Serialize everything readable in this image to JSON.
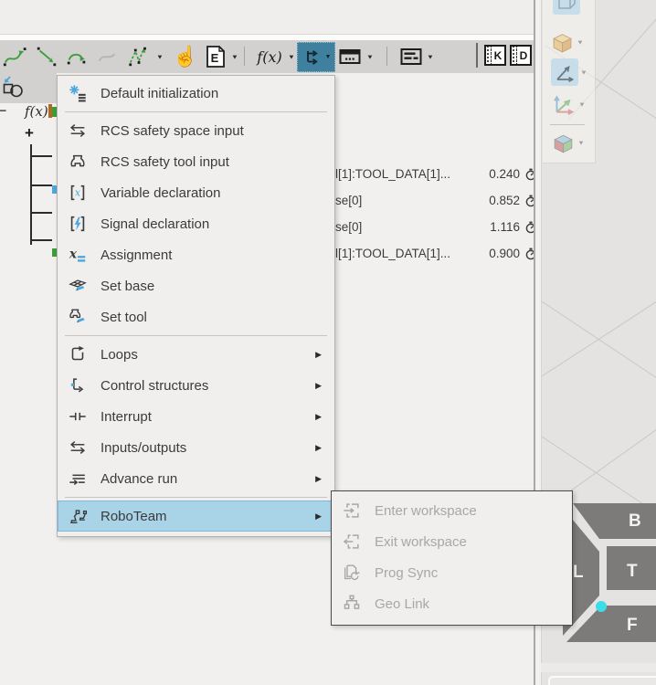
{
  "toolbar": {
    "e_button": "E",
    "fx_button": "f(x)",
    "k_button": "K",
    "d_button": "D",
    "selected_tool": "logic-commands",
    "motion_icons": [
      "spline-motion-icon",
      "linear-motion-icon",
      "circular-motion-icon",
      "spline-disabled-icon",
      "ptp-motion-icon",
      "grab-hand-icon"
    ]
  },
  "glyphs": {
    "caret_down": "▼",
    "submenu_arrow": "▶",
    "hand": "☝"
  },
  "tree": {
    "collapse_glyph": "−",
    "expand_glyph": "+",
    "fx_label": "f(x)"
  },
  "program_rows": [
    {
      "name": "l[1]:TOOL_DATA[1]...",
      "value": "0.240",
      "icon": "duration-clock-icon"
    },
    {
      "name": "se[0]",
      "value": "0.852",
      "icon": "duration-clock-icon"
    },
    {
      "name": "se[0]",
      "value": "1.116",
      "icon": "duration-clock-icon"
    },
    {
      "name": "l[1]:TOOL_DATA[1]...",
      "value": "0.900",
      "icon": "duration-clock-icon"
    }
  ],
  "menu": {
    "items": [
      {
        "label": "Default initialization",
        "icon": "default-initialization-icon",
        "has_submenu": false,
        "separator_after": true
      },
      {
        "label": "RCS safety space input",
        "icon": "safety-space-icon",
        "has_submenu": false
      },
      {
        "label": "RCS safety tool input",
        "icon": "safety-tool-icon",
        "has_submenu": false
      },
      {
        "label": "Variable declaration",
        "icon": "variable-declaration-icon",
        "has_submenu": false
      },
      {
        "label": "Signal declaration",
        "icon": "signal-declaration-icon",
        "has_submenu": false
      },
      {
        "label": "Assignment",
        "icon": "assignment-icon",
        "has_submenu": false
      },
      {
        "label": "Set base",
        "icon": "set-base-icon",
        "has_submenu": false
      },
      {
        "label": "Set tool",
        "icon": "set-tool-icon",
        "has_submenu": false,
        "separator_after": true
      },
      {
        "label": "Loops",
        "icon": "loop-icon",
        "has_submenu": true
      },
      {
        "label": "Control structures",
        "icon": "control-structures-icon",
        "has_submenu": true
      },
      {
        "label": "Interrupt",
        "icon": "interrupt-icon",
        "has_submenu": true
      },
      {
        "label": "Inputs/outputs",
        "icon": "inputs-outputs-icon",
        "has_submenu": true
      },
      {
        "label": "Advance run",
        "icon": "advance-run-icon",
        "has_submenu": true,
        "separator_after": true
      },
      {
        "label": "RoboTeam",
        "icon": "roboteam-icon",
        "has_submenu": true,
        "highlighted": true
      }
    ]
  },
  "submenu": {
    "items": [
      {
        "label": "Enter workspace",
        "icon": "enter-workspace-icon",
        "enabled": false
      },
      {
        "label": "Exit workspace",
        "icon": "exit-workspace-icon",
        "enabled": false
      },
      {
        "label": "Prog Sync",
        "icon": "prog-sync-icon",
        "enabled": false
      },
      {
        "label": "Geo Link",
        "icon": "geo-link-icon",
        "enabled": false
      }
    ]
  },
  "viewcube": {
    "back": "B",
    "top": "T",
    "left": "L",
    "front": "F"
  },
  "colors": {
    "accent_blue": "#4da6dc",
    "selected_teal": "#3e809e",
    "menu_highlight": "#a9d4e7",
    "motion_green": "#3a9e3a",
    "cube_face": "#7c7b79",
    "cube_dot": "#3bdde6"
  }
}
